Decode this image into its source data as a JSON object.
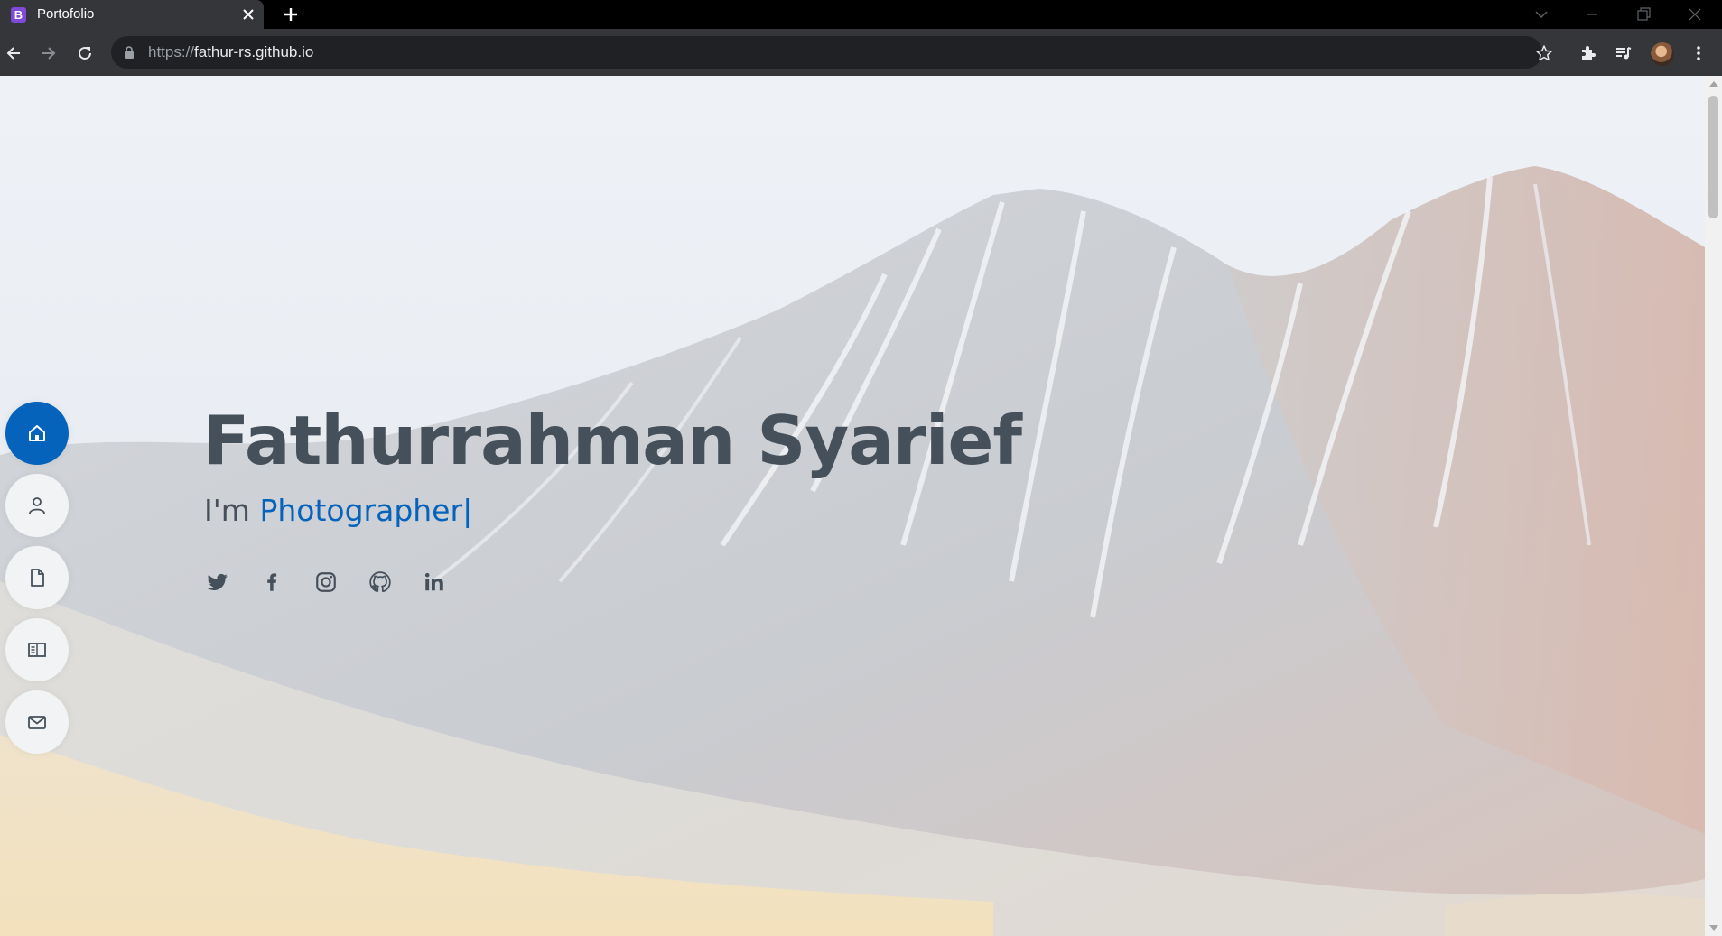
{
  "browser": {
    "tab_title": "Portofolio",
    "tab_favicon_letter": "B",
    "url_scheme": "https://",
    "url_host": "fathur-rs.github.io",
    "accent": "#35363a"
  },
  "nav": {
    "items": [
      {
        "name": "home",
        "icon": "home-icon",
        "active": true
      },
      {
        "name": "about",
        "icon": "user-icon",
        "active": false
      },
      {
        "name": "resume",
        "icon": "file-icon",
        "active": false
      },
      {
        "name": "portfolio",
        "icon": "book-icon",
        "active": false
      },
      {
        "name": "contact",
        "icon": "envelope-icon",
        "active": false
      }
    ],
    "active_color": "#0563bb"
  },
  "hero": {
    "name": "Fathurrahman Syarief",
    "prefix": "I'm",
    "role": "Photographer",
    "cursor": "|",
    "text_color": "#45505b",
    "accent_color": "#0563bb",
    "socials": [
      "twitter-icon",
      "facebook-icon",
      "instagram-icon",
      "github-icon",
      "linkedin-icon"
    ]
  }
}
